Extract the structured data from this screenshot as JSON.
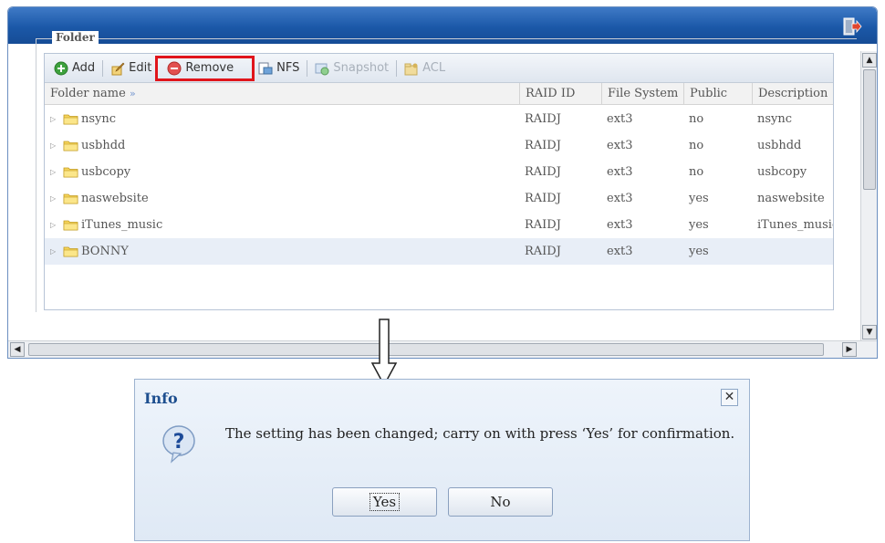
{
  "fieldset": {
    "legend": "Folder"
  },
  "toolbar": {
    "add": "Add",
    "edit": "Edit",
    "remove": "Remove",
    "nfs": "NFS",
    "snapshot": "Snapshot",
    "acl": "ACL"
  },
  "grid": {
    "headers": {
      "folder_name": "Folder name",
      "raid_id": "RAID ID",
      "file_system": "File System",
      "public": "Public",
      "description": "Description"
    },
    "rows": [
      {
        "name": "nsync",
        "raid": "RAIDJ",
        "fs": "ext3",
        "public": "no",
        "desc": "nsync"
      },
      {
        "name": "usbhdd",
        "raid": "RAIDJ",
        "fs": "ext3",
        "public": "no",
        "desc": "usbhdd"
      },
      {
        "name": "usbcopy",
        "raid": "RAIDJ",
        "fs": "ext3",
        "public": "no",
        "desc": "usbcopy"
      },
      {
        "name": "naswebsite",
        "raid": "RAIDJ",
        "fs": "ext3",
        "public": "yes",
        "desc": "naswebsite"
      },
      {
        "name": "iTunes_music",
        "raid": "RAIDJ",
        "fs": "ext3",
        "public": "yes",
        "desc": "iTunes_music"
      },
      {
        "name": "BONNY",
        "raid": "RAIDJ",
        "fs": "ext3",
        "public": "yes",
        "desc": ""
      }
    ]
  },
  "dialog": {
    "title": "Info",
    "message": "The setting has been changed; carry on with press ‘Yes’ for confirmation.",
    "yes": "Yes",
    "no": "No"
  },
  "colors": {
    "titlebar": "#1b58a8",
    "highlight_box": "#e0151c",
    "dialog_title": "#1e4f8f",
    "selected_row": "#e8eef7"
  },
  "icons": {
    "logout": "logout-icon",
    "add": "add-icon",
    "edit": "edit-icon",
    "remove": "remove-icon",
    "nfs": "nfs-icon",
    "snapshot": "snapshot-icon",
    "acl": "acl-icon",
    "folder": "folder-icon",
    "question": "question-icon",
    "close": "close-icon"
  }
}
